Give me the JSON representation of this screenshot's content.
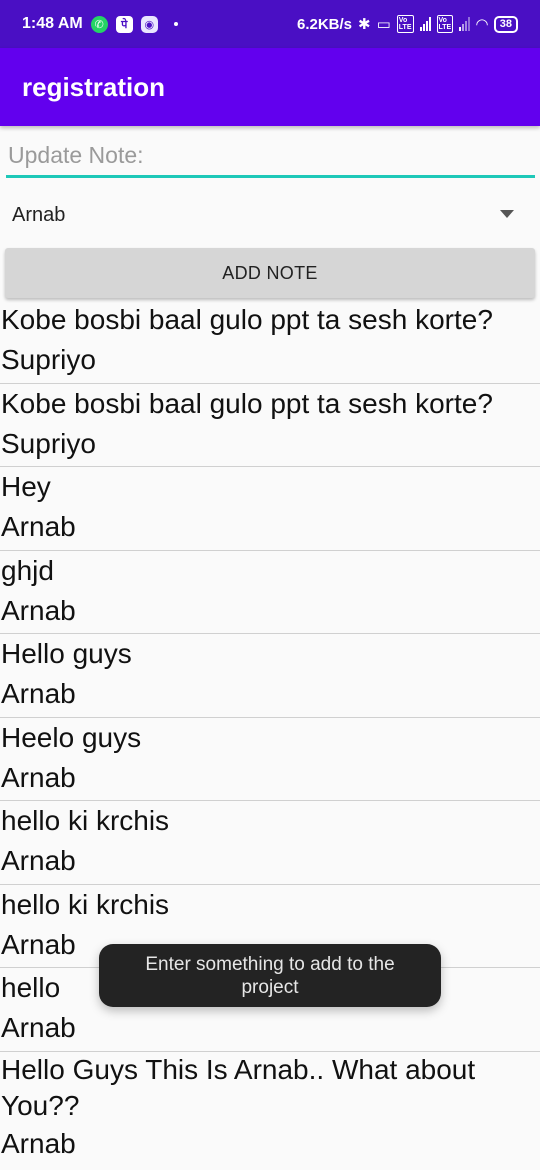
{
  "status_bar": {
    "time": "1:48 AM",
    "network_speed": "6.2KB/s",
    "battery": "38",
    "icons": [
      "whatsapp-icon",
      "phonepe-icon",
      "discord-icon",
      "bluetooth-icon",
      "volte-icon",
      "signal-icon",
      "wifi-icon",
      "battery-icon"
    ]
  },
  "app_bar": {
    "title": "registration"
  },
  "note_input": {
    "placeholder": "Update Note:",
    "value": ""
  },
  "spinner": {
    "selected": "Arnab"
  },
  "add_button": {
    "label": "ADD NOTE"
  },
  "notes": [
    {
      "text": "Kobe bosbi baal gulo ppt ta sesh korte?",
      "author": "Supriyo"
    },
    {
      "text": "Kobe bosbi baal gulo ppt ta sesh korte?",
      "author": "Supriyo"
    },
    {
      "text": "Hey",
      "author": "Arnab"
    },
    {
      "text": "ghjd",
      "author": "Arnab"
    },
    {
      "text": "Hello guys",
      "author": "Arnab"
    },
    {
      "text": "Heelo guys",
      "author": "Arnab"
    },
    {
      "text": "hello ki krchis",
      "author": "Arnab"
    },
    {
      "text": "hello ki krchis",
      "author": "Arnab"
    },
    {
      "text": "hello",
      "author": "Arnab"
    },
    {
      "text": "Hello Guys This Is Arnab.. What about You??",
      "author": "Arnab"
    }
  ],
  "toast": {
    "message": "Enter something to add to the project"
  },
  "colors": {
    "status_bar": "#4a0fc4",
    "app_bar": "#6200ee",
    "input_underline": "#1ec8b8",
    "button": "#d6d6d6",
    "toast": "#232323"
  }
}
